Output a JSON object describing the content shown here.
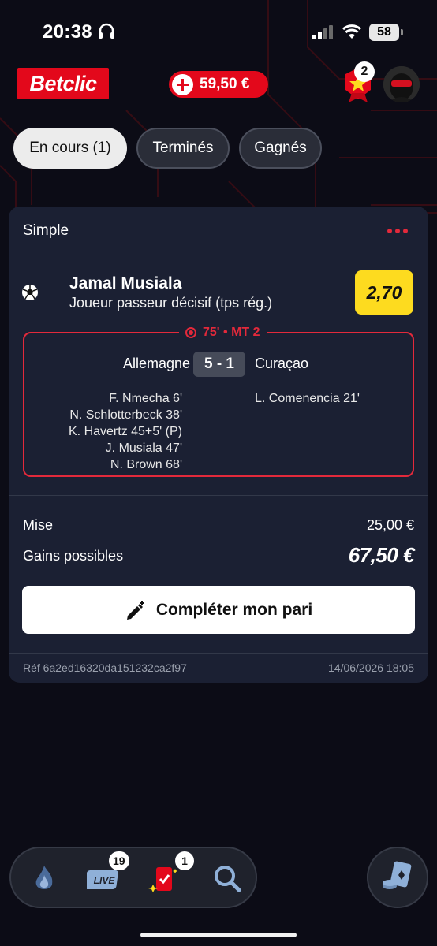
{
  "status_bar": {
    "time": "20:38",
    "battery": "58"
  },
  "header": {
    "logo": "Betclic",
    "balance": "59,50 €",
    "badge_count": "2"
  },
  "tabs": [
    {
      "label": "En cours (1)",
      "active": true
    },
    {
      "label": "Terminés",
      "active": false
    },
    {
      "label": "Gagnés",
      "active": false
    }
  ],
  "bet": {
    "type": "Simple",
    "player": "Jamal Musiala",
    "market": "Joueur passeur décisif (tps rég.)",
    "odds": "2,70",
    "live_status": "75' • MT 2",
    "home_team": "Allemagne",
    "away_team": "Curaçao",
    "score": "5 - 1",
    "home_scorers": [
      "F. Nmecha 6'",
      "N. Schlotterbeck 38'",
      "K. Havertz 45+5' (P)",
      "J. Musiala 47'",
      "N. Brown 68'"
    ],
    "away_scorers": [
      "L. Comenencia 21'"
    ],
    "stake_label": "Mise",
    "stake_value": "25,00 €",
    "gains_label": "Gains possibles",
    "gains_value": "67,50 €",
    "complete_button": "Compléter mon pari",
    "reference": "Réf 6a2ed16320da151232ca2f97",
    "date": "14/06/2026 18:05"
  },
  "bottom_nav": {
    "live_badge": "19",
    "bets_badge": "1"
  },
  "colors": {
    "brand_red": "#e3081b",
    "odds_yellow": "#fddb1f",
    "card_bg": "#1b2033",
    "page_bg": "#0c0c16"
  }
}
